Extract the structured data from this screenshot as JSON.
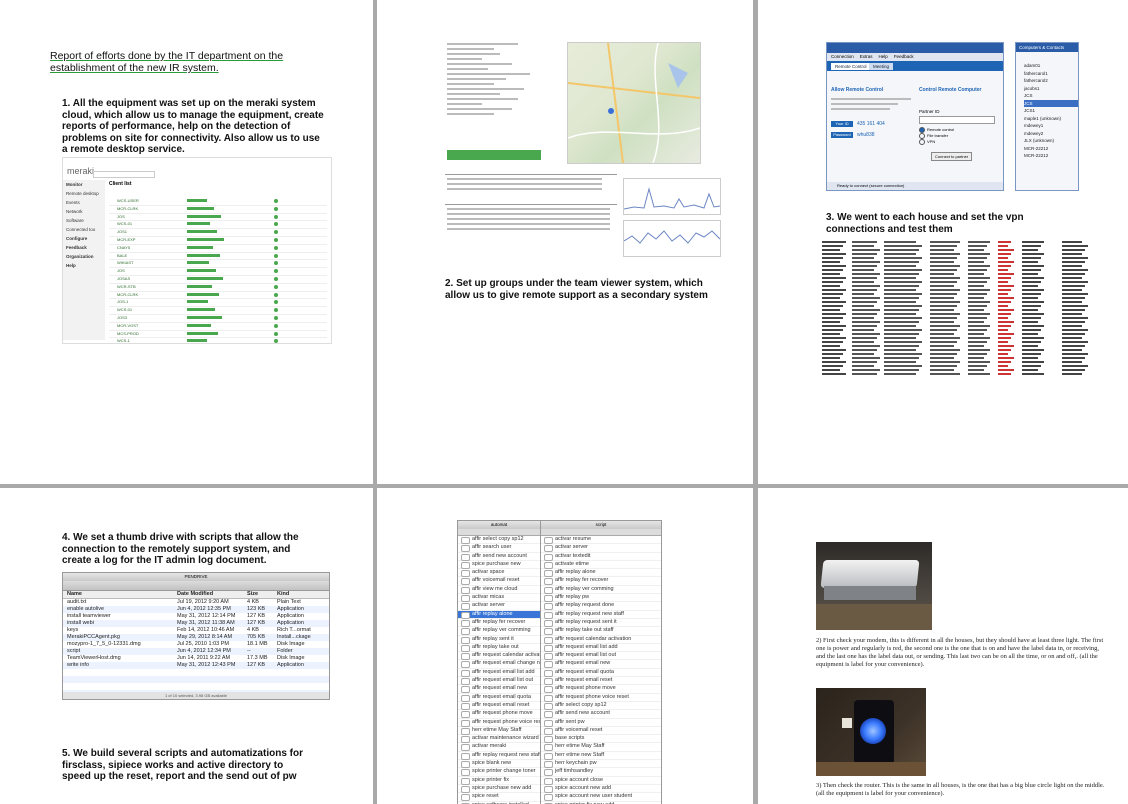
{
  "page1": {
    "heading": "Report of efforts done by the IT department on the establishment of the new IR system.",
    "item1": "1.  All the equipment was set up on the meraki system cloud, which allow us to manage the equipment, create reports of performance, help on the detection of problems on site for connectivity. Also allow us to use a remote desktop service.",
    "screenshot": {
      "brand": "meraki",
      "nav": [
        "Monitor",
        "Remote desktop",
        "Events",
        "Network",
        "Software",
        "Connected too",
        "Configure",
        "Feedback",
        "Organization",
        "Help"
      ],
      "title": "Client list",
      "rows": [
        "WCS-USER",
        "MCR-CLRK",
        "JOS",
        "WCS-01",
        "JOS1",
        "MCR-EXP",
        "CNAY5",
        "BALE",
        "WIKIAST",
        "JOS",
        "JOSAS",
        "WCR-STB",
        "MCR-CLRK",
        "JOS-1",
        "WCS-01",
        "JOS3",
        "MCR-VOST",
        "MCS-PROD",
        "WCS-1",
        "MCR-CLRK"
      ]
    }
  },
  "page2": {
    "item2": "2.  Set up groups under the team viewer system, which allow us to give remote support as a secondary system",
    "screenshot": {
      "labels": [
        "Live tools",
        "Last user",
        "Wireless adapter",
        "Disk usage",
        "Network status",
        "Online status",
        "Network adapters",
        "Client performance",
        "Installed software",
        "Processor utilization",
        "Memory usage"
      ],
      "links": [
        "Remote Desktop",
        "Screenshot",
        "Reboot",
        "Process list"
      ]
    }
  },
  "page3": {
    "item3": "3.  We went to each house and set the vpn connections and test them",
    "teamviewer": {
      "menu": [
        "Connection",
        "Extras",
        "Help",
        "Feedback"
      ],
      "tabs": [
        "Remote Control",
        "Meeting"
      ],
      "allow_title": "Allow Remote Control",
      "control_title": "Control Remote Computer",
      "your_id_label": "Your ID",
      "your_id": "435 161 404",
      "password_label": "Password",
      "password": "whu838",
      "partner_label": "Partner ID",
      "options": [
        "Remote control",
        "File transfer",
        "VPN"
      ],
      "connect_button": "Connect to partner",
      "status": "Ready to connect (secure connection)",
      "side_title": "Computers & Contacts",
      "side_items": [
        "adam01",
        "fathercarol1",
        "fathercarol2",
        "jacobs1",
        "JCS",
        "JCS",
        "JCS1",
        "maple1 (unknown)",
        "mdewey1",
        "mdewey2",
        "JLX (unknown)",
        "MCR-22212",
        "MCR-22212"
      ]
    }
  },
  "page4": {
    "item4": "4.  We set a thumb drive with scripts that allow the connection to the remotely support system, and create a log for the IT admin log document.",
    "item5": "5.  We build several scripts and automatizations for firsclass, sipiece works and active directory to speed up the reset, report and the send out of pw",
    "finder": {
      "title": "PENDRIVE",
      "columns": [
        "Name",
        "Date Modified",
        "Size",
        "Kind"
      ],
      "rows": [
        [
          "audit.txt",
          "Jul 19, 2012 9:20 AM",
          "4 KB",
          "Plain Text"
        ],
        [
          "enable autolive",
          "Jun 4, 2012 12:35 PM",
          "123 KB",
          "Application"
        ],
        [
          "install teamviewer",
          "May 31, 2012 12:14 PM",
          "127 KB",
          "Application"
        ],
        [
          "install webi",
          "May 31, 2012 11:38 AM",
          "127 KB",
          "Application"
        ],
        [
          "keys",
          "Feb 14, 2012 10:46 AM",
          "4 KB",
          "Rich T...ormat"
        ],
        [
          "MerakiPCCAgent.pkg",
          "May 29, 2012 8:14 AM",
          "705 KB",
          "Install...ckage"
        ],
        [
          "mozypro-1_7_5_0-12331.dmg",
          "Jul 25, 2010 1:03 PM",
          "18.1 MB",
          "Disk Image"
        ],
        [
          "script",
          "Jun 4, 2012 12:34 PM",
          "--",
          "Folder"
        ],
        [
          "TeamViewerHost.dmg",
          "Jun 14, 2011 9:22 AM",
          "17.3 MB",
          "Disk Image"
        ],
        [
          "write info",
          "May 31, 2012 12:43 PM",
          "127 KB",
          "Application"
        ]
      ],
      "footer": "1 of 10 selected, 3.98 GB available"
    }
  },
  "page5": {
    "left_title": "automat",
    "right_title": "script",
    "left_rows": [
      "affir select copy sp12",
      "affir search user",
      "affir send new account",
      "spice purchase new",
      "activar space",
      "affir voicemail reset",
      "affir view me cloud",
      "activar micas",
      "activar server",
      "affir replay alone",
      "affir replay fer recover",
      "affir replay ver comming",
      "affir replay sent it",
      "affir replay take out",
      "affir request calendar activati",
      "affir request email change nai",
      "affir request email list add",
      "affir request email list out",
      "affir request email new",
      "affir request email quota",
      "affir request email reset",
      "affir request phone move",
      "affir request phone voice rese",
      "herr etime May Staff",
      "activar maintenance wizard",
      "activar meraki",
      "affir replay request new staff",
      "spice blank new",
      "spice printer change toner",
      "spice printer fix",
      "spice purchase new add",
      "spice reset",
      "spice software installed",
      "spice software updated"
    ],
    "right_rows": [
      "activar resume",
      "activar server",
      "activar textedit",
      "activate etime",
      "affir replay alone",
      "affir replay fer recover",
      "affir replay ver comming",
      "affir replay pw",
      "affir replay request done",
      "affir replay request new staff",
      "affir replay request sent it",
      "affir replay take out staff",
      "affir request calendar activation",
      "affir request email list add",
      "affir request email list out",
      "affir request email new",
      "affir request email quota",
      "affir request email reset",
      "affir request phone move",
      "affir request phone voice reset",
      "affir select copy sp12",
      "affir send new account",
      "affir sent pw",
      "affir voicemail reset",
      "base scripts",
      "herr etime May Staff",
      "herr etime new Staff",
      "herr keychain pw",
      "jeff timhsandley",
      "spice account close",
      "spice account new add",
      "spice account new user student",
      "spice printer fix new add"
    ]
  },
  "page6": {
    "caption1": "2) First check your modem, this is different in all the houses, but they should have at least three light. The first one is power and regularly is red, the second one is the one that is on and have the label data in, or receiving, and the last one has the label data out, or sending. This last two can be on all the time, or on and off,. (all the equipment is label for your convenience).",
    "caption2": "3) Then check the router. This is the same in all houses, is the one that has a big blue circle light on the middle. (all the equipment is label for your convenience)."
  },
  "colors": {
    "gray_bg": "#a9a9a9",
    "meraki_green": "#49a84d",
    "teamviewer_blue": "#1e64b4",
    "router_blue": "#3b7bff"
  }
}
